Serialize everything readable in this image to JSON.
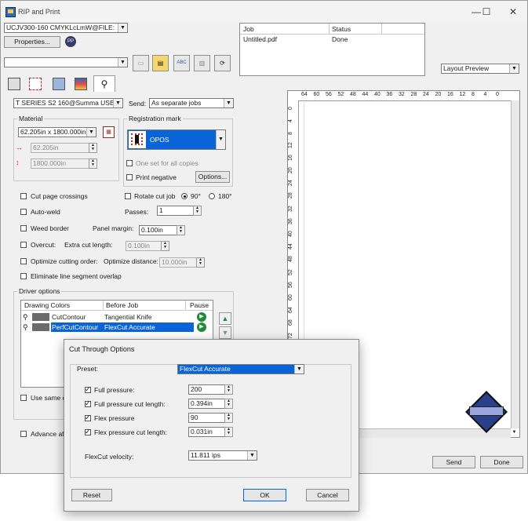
{
  "window": {
    "title": "RIP and Print",
    "controls": {
      "minimize": "—",
      "maximize": "☐",
      "close": "✕"
    }
  },
  "printer": {
    "selected": "UCJV300-160 CMYKLcLmW@FILE:",
    "properties_label": "Properties..."
  },
  "jobs_table": {
    "headers": [
      "Job",
      "Status"
    ],
    "rows": [
      {
        "job": "Untitled.pdf",
        "status": "Done"
      }
    ]
  },
  "toolbar": {
    "job_combo_value": ""
  },
  "layout": {
    "view_select": "Layout Preview"
  },
  "cutter": {
    "device": "T SERIES S2 160@Summa USB",
    "send_label": "Send:",
    "send_value": "As separate jobs"
  },
  "material": {
    "group_label": "Material",
    "size": "62.205in x 1800.000in",
    "width": "62.205in",
    "height": "1800.000in"
  },
  "registration": {
    "group_label": "Registration mark",
    "mark": "OPOS",
    "one_set_label": "One set for all copies",
    "print_negative_label": "Print negative",
    "options_label": "Options..."
  },
  "options": {
    "cut_page_crossings": "Cut page crossings",
    "rotate_cut_job": "Rotate cut job",
    "rot_90": "90°",
    "rot_180": "180°",
    "auto_weld": "Auto-weld",
    "passes_label": "Passes:",
    "passes": "1",
    "weed_border": "Weed border",
    "panel_margin_label": "Panel margin:",
    "panel_margin": "0.100in",
    "overcut": "Overcut:",
    "extra_cut_label": "Extra cut length:",
    "extra_cut": "0.100in",
    "optimize_order": "Optimize cutting order:",
    "optimize_distance_label": "Optimize distance:",
    "optimize_distance": "10.000in",
    "eliminate_overlap": "Eliminate line segment overlap"
  },
  "driver": {
    "group_label": "Driver options",
    "headers": [
      "Drawing Colors",
      "Before Job",
      "Pause"
    ],
    "rows": [
      {
        "name": "CutContour",
        "action": "Tangential Knife"
      },
      {
        "name": "PerfCutContour",
        "action": "FlexCut Accurate"
      }
    ],
    "use_same_partial": "Use same d",
    "advance_partial": "Advance af"
  },
  "ruler": {
    "top": [
      "64",
      "60",
      "56",
      "52",
      "48",
      "44",
      "40",
      "36",
      "32",
      "28",
      "24",
      "20",
      "16",
      "12",
      "8",
      "4",
      "0"
    ],
    "left": [
      "0",
      "4",
      "8",
      "12",
      "16",
      "20",
      "24",
      "28",
      "32",
      "36",
      "40",
      "44",
      "48",
      "52",
      "56",
      "60",
      "64",
      "68",
      "72",
      "76",
      "80",
      "84",
      "88",
      "92",
      "96"
    ]
  },
  "bottom_buttons": {
    "send": "Send",
    "done": "Done"
  },
  "dialog": {
    "title": "Cut Through Options",
    "preset_label": "Preset:",
    "preset": "FlexCut Accurate",
    "rows": [
      {
        "label": "Full pressure:",
        "value": "200"
      },
      {
        "label": "Full pressure cut length:",
        "value": "0.394in"
      },
      {
        "label": "Flex pressure",
        "value": "90"
      },
      {
        "label": "Flex pressure cut length:",
        "value": "0.031in"
      }
    ],
    "velocity_label": "FlexCut velocity:",
    "velocity": "11.811 ips",
    "reset": "Reset",
    "ok": "OK",
    "cancel": "Cancel"
  },
  "colors": {
    "accent": "#0a64d8",
    "swatch": "#6b6b6b"
  }
}
